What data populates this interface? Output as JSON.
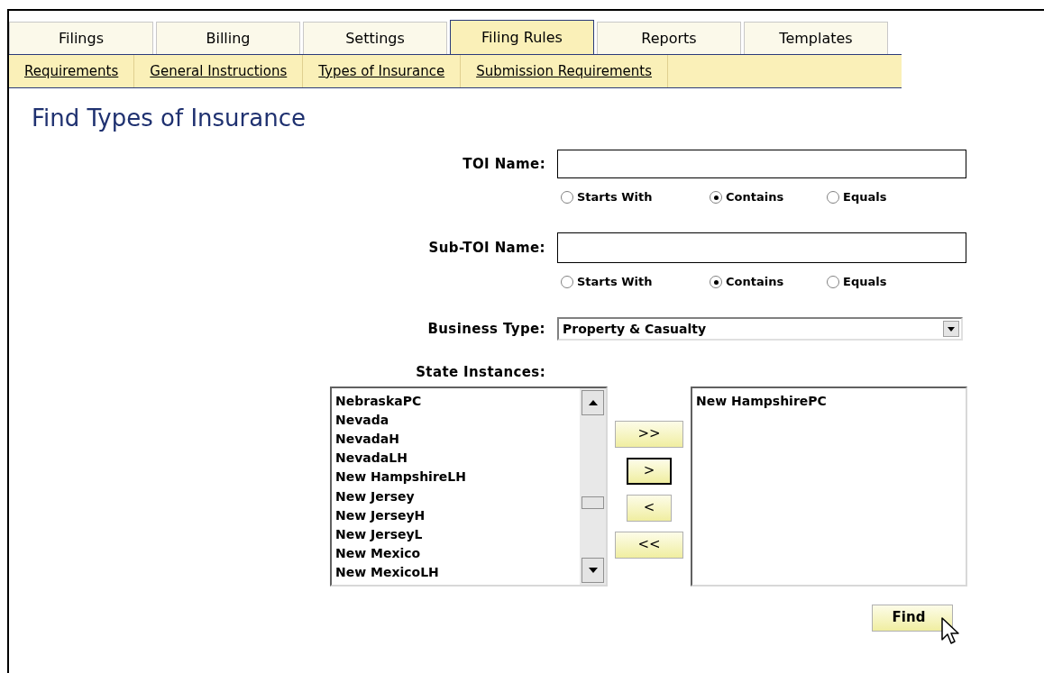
{
  "tabs": [
    {
      "label": "Filings",
      "selected": false
    },
    {
      "label": "Billing",
      "selected": false
    },
    {
      "label": "Settings",
      "selected": false
    },
    {
      "label": "Filing Rules",
      "selected": true
    },
    {
      "label": "Reports",
      "selected": false
    },
    {
      "label": "Templates",
      "selected": false
    }
  ],
  "subnav": [
    "Requirements",
    "General Instructions",
    "Types of Insurance",
    "Submission Requirements"
  ],
  "title": "Find Types of Insurance",
  "toi_name": {
    "label": "TOI Name:",
    "options": [
      {
        "label": "Starts With",
        "selected": false
      },
      {
        "label": "Contains",
        "selected": true
      },
      {
        "label": "Equals",
        "selected": false
      }
    ]
  },
  "sub_toi_name": {
    "label": "Sub-TOI Name:",
    "options": [
      {
        "label": "Starts With",
        "selected": false
      },
      {
        "label": "Contains",
        "selected": true
      },
      {
        "label": "Equals",
        "selected": false
      }
    ]
  },
  "business_type": {
    "label": "Business Type:",
    "value": "Property & Casualty"
  },
  "state_instances": {
    "label": "State Instances:",
    "available": [
      "NebraskaPC",
      "Nevada",
      "NevadaH",
      "NevadaLH",
      "New HampshireLH",
      "New Jersey",
      "New JerseyH",
      "New JerseyL",
      "New Mexico",
      "New MexicoLH"
    ],
    "move_buttons": [
      {
        "label": ">>",
        "focused": false
      },
      {
        "label": ">",
        "focused": true
      },
      {
        "label": "<",
        "focused": false
      },
      {
        "label": "<<",
        "focused": false
      }
    ],
    "chosen": [
      "New HampshirePC"
    ]
  },
  "find_button": "Find"
}
